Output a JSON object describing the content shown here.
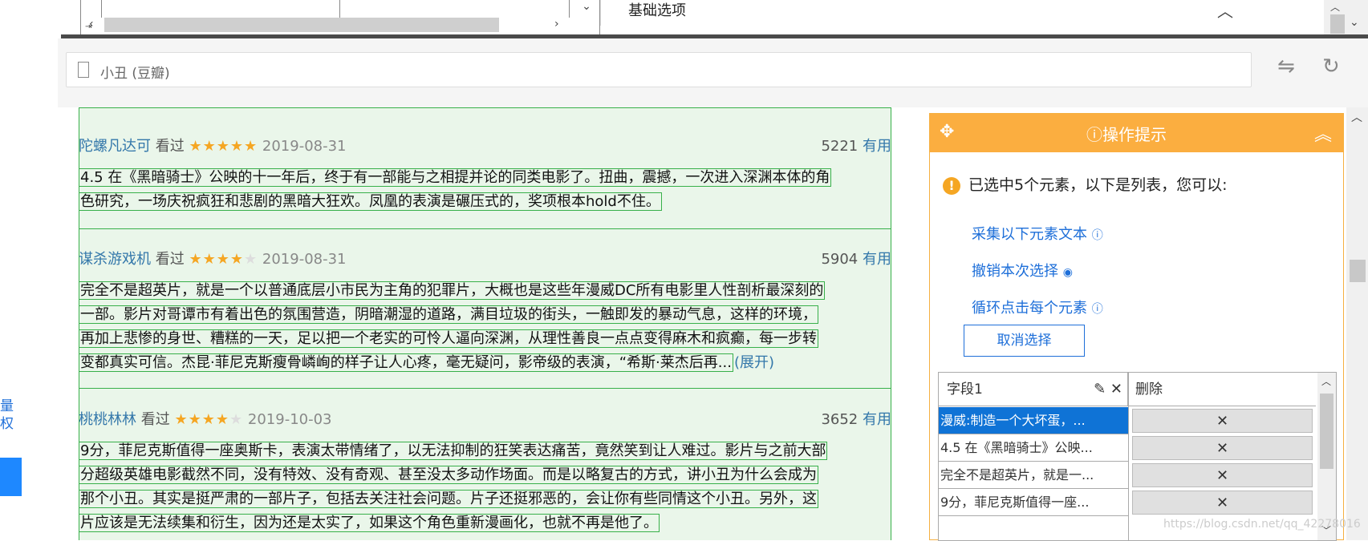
{
  "top": {
    "basic_options": "基础选项"
  },
  "address": {
    "title": "小丑 (豆瓣)"
  },
  "left": {
    "char1": "量",
    "char2": "权"
  },
  "reviews": [
    {
      "user": "陀螺凡达可",
      "seen": "看过",
      "stars": 5,
      "date": "2019-08-31",
      "count": "5221",
      "useful": "有用",
      "lines": [
        "4.5 在《黑暗骑士》公映的十一年后，终于有一部能与之相提并论的同类电影了。扭曲，震撼，一次进入深渊本体的角",
        "色研究，一场庆祝疯狂和悲剧的黑暗大狂欢。凤凰的表演是碾压式的，奖项根本hold不住。"
      ]
    },
    {
      "user": "谋杀游戏机",
      "seen": "看过",
      "stars": 4,
      "date": "2019-08-31",
      "count": "5904",
      "useful": "有用",
      "lines": [
        "完全不是超英片，就是一个以普通底层小市民为主角的犯罪片，大概也是这些年漫威DC所有电影里人性剖析最深刻的",
        "一部。影片对哥谭市有着出色的氛围营造，阴暗潮湿的道路，满目垃圾的街头，一触即发的暴动气息，这样的环境，",
        "再加上悲惨的身世、糟糕的一天，足以把一个老实的可怜人逼向深渊，从理性善良一点点变得麻木和疯癫，每一步转",
        "变都真实可信。杰昆·菲尼克斯瘦骨嶙峋的样子让人心疼，毫无疑问，影帝级的表演，“希斯·莱杰后再..."
      ],
      "expand": "(展开)"
    },
    {
      "user": "桃桃林林",
      "seen": "看过",
      "stars": 4,
      "date": "2019-10-03",
      "count": "3652",
      "useful": "有用",
      "lines": [
        "9分，菲尼克斯值得一座奥斯卡，表演太带情绪了，以无法抑制的狂笑表达痛苦，竟然笑到让人难过。影片与之前大部",
        "分超级英雄电影截然不同，没有特效、没有奇观、甚至没太多动作场面。而是以略复古的方式，讲小丑为什么会成为",
        "那个小丑。其实是挺严肃的一部片子，包括去关注社会问题。片子还挺邪恶的，会让你有些同情这个小丑。另外，这",
        "片应该是无法续集和衍生，因为还是太实了，如果这个角色重新漫画化，也就不再是他了。"
      ]
    }
  ],
  "tip": {
    "title": "操作提示",
    "message": "已选中5个元素，以下是列表，您可以:",
    "links": [
      "采集以下元素文本",
      "撤销本次选择",
      "循环点击每个元素"
    ],
    "cancel": "取消选择",
    "table": {
      "col1": "字段1",
      "col2": "删除",
      "rows": [
        "漫威:制造一个大坏蛋，...",
        "4.5 在《黑暗骑士》公映...",
        "完全不是超英片，就是一...",
        "9分，菲尼克斯值得一座..."
      ]
    }
  },
  "watermark": "https://blog.csdn.net/qq_42278016"
}
